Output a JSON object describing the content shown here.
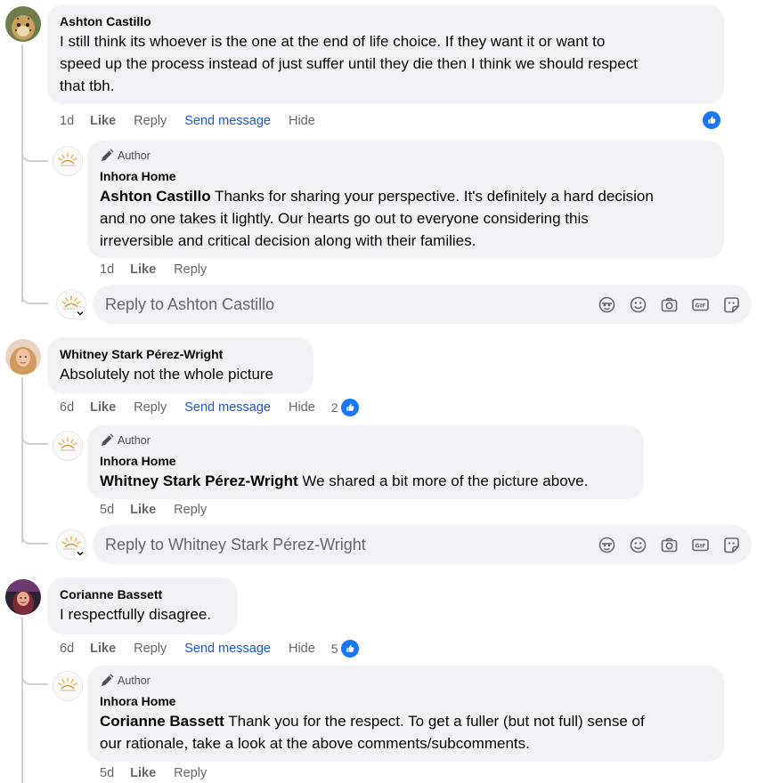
{
  "comments": [
    {
      "author": "Ashton Castillo",
      "text_lines": [
        "I still think its whoever is the one at the end of life choice. If they want it or want to",
        "speed up the process instead of just suffer until they die then I think we should respect",
        "that tbh."
      ],
      "time": "1d",
      "like": "Like",
      "reply": "Reply",
      "send_message": "Send message",
      "hide": "Hide",
      "reaction_count": "",
      "reply_comment": {
        "badge": "Author",
        "author": "Inhora Home",
        "tag": "Ashton Castillo",
        "text_lines": [
          " Thanks for sharing your perspective. It's definitely a hard decision",
          "and no one takes it lightly. Our hearts go out to everyone considering this",
          "irreversible and critical decision along with their families."
        ],
        "time": "1d",
        "like": "Like",
        "reply": "Reply"
      },
      "reply_placeholder": "Reply to Ashton Castillo"
    },
    {
      "author": "Whitney Stark Pérez-Wright",
      "text_lines": [
        "Absolutely not the whole picture"
      ],
      "time": "6d",
      "like": "Like",
      "reply": "Reply",
      "send_message": "Send message",
      "hide": "Hide",
      "reaction_count": "2",
      "reply_comment": {
        "badge": "Author",
        "author": "Inhora Home",
        "tag": "Whitney Stark Pérez-Wright",
        "text_lines": [
          " We shared a bit more of the picture above."
        ],
        "time": "5d",
        "like": "Like",
        "reply": "Reply"
      },
      "reply_placeholder": "Reply to Whitney Stark Pérez-Wright"
    },
    {
      "author": "Corianne Bassett",
      "text_lines": [
        "I respectfully disagree."
      ],
      "time": "6d",
      "like": "Like",
      "reply": "Reply",
      "send_message": "Send message",
      "hide": "Hide",
      "reaction_count": "5",
      "reply_comment": {
        "badge": "Author",
        "author": "Inhora Home",
        "tag": "Corianne Bassett",
        "text_lines": [
          " Thank you for the respect. To get a fuller (but not full) sense of",
          "our rationale, take a look at the above comments/subcomments."
        ],
        "time": "5d",
        "like": "Like",
        "reply": "Reply"
      }
    }
  ],
  "reply_icons": [
    "avatar-sticker-icon",
    "emoji-icon",
    "camera-icon",
    "gif-icon",
    "sticker-icon"
  ],
  "colors": {
    "bubble": "#f0f2f5",
    "like_blue": "#1877f2",
    "send_message": "#1a56db",
    "meta_gray": "#65676b",
    "thread_line": "#ced0d4"
  }
}
